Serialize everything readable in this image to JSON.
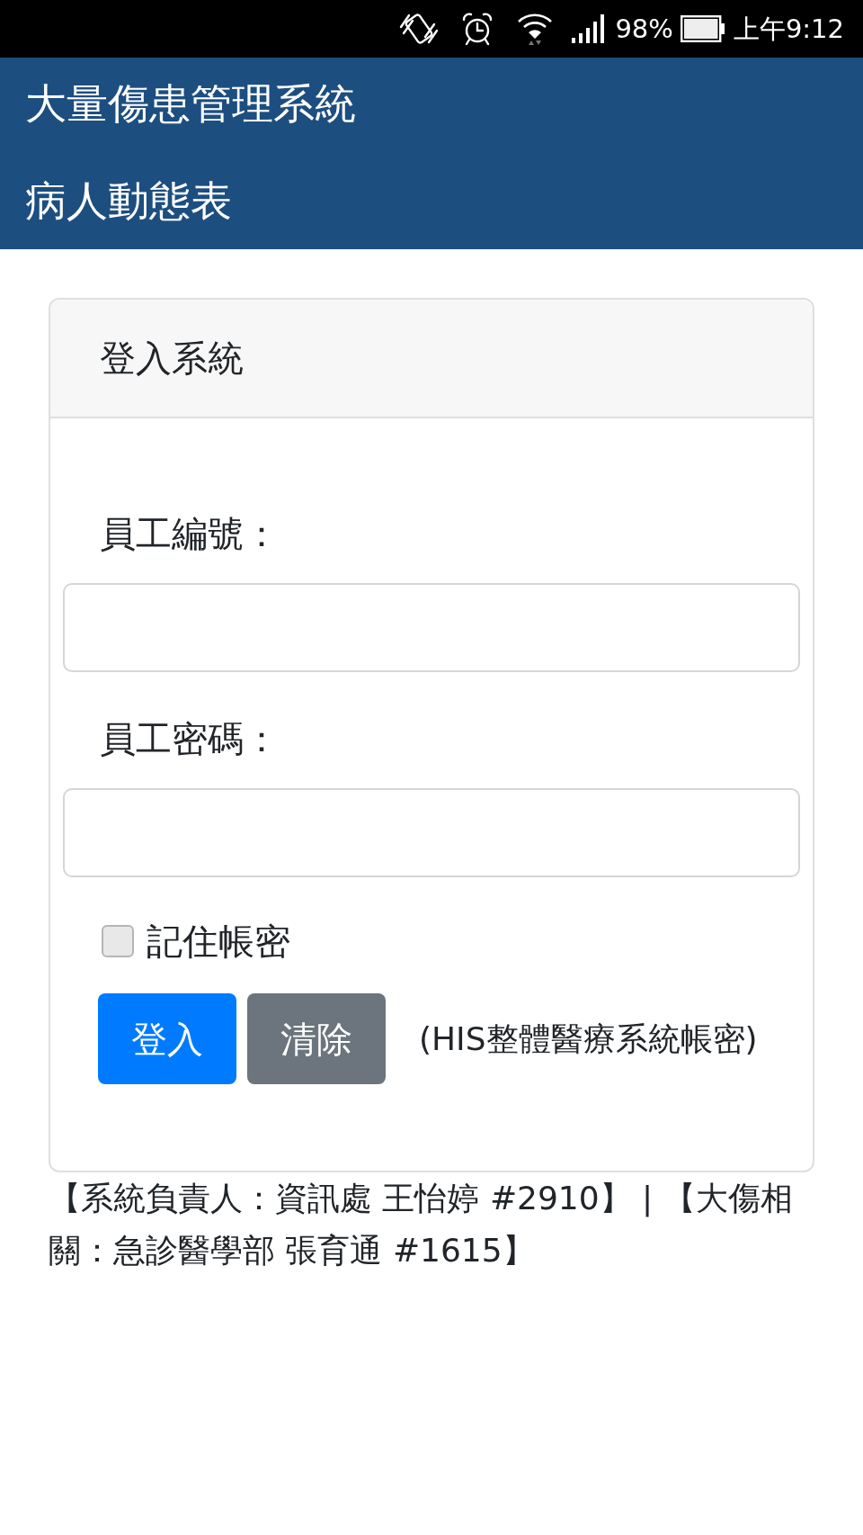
{
  "status_bar": {
    "battery": "98%",
    "time": "上午9:12"
  },
  "header": {
    "title": "大量傷患管理系統",
    "subtitle": "病人動態表"
  },
  "login_card": {
    "title": "登入系統",
    "fields": [
      {
        "label": "員工編號："
      },
      {
        "label": "員工密碼："
      }
    ],
    "remember": {
      "label": "記住帳密",
      "checked": false
    },
    "buttons": [
      {
        "label": "登入",
        "kind": "primary"
      },
      {
        "label": "清除",
        "kind": "secondary"
      }
    ],
    "note": "(HIS整體醫療系統帳密)"
  },
  "footer": "【系統負責人：資訊處 王怡婷 #2910】 | 【大傷相關：急診醫學部 張育通 #1615】"
}
